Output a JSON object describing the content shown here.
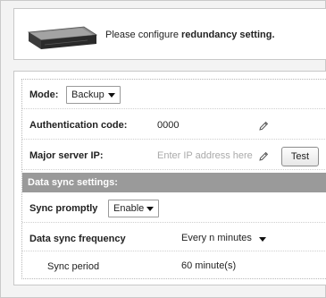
{
  "header": {
    "message_prefix": "Please configure ",
    "message_bold": "redundancy setting."
  },
  "form": {
    "mode": {
      "label": "Mode:",
      "value": "Backup"
    },
    "auth_code": {
      "label": "Authentication code:",
      "value": "0000"
    },
    "major_server_ip": {
      "label": "Major server IP:",
      "placeholder": "Enter IP address here",
      "test_button": "Test"
    },
    "data_sync_section": {
      "title": "Data sync settings:"
    },
    "sync_promptly": {
      "label": "Sync promptly",
      "value": "Enable"
    },
    "data_sync_frequency": {
      "label": "Data sync frequency",
      "value": "Every n minutes"
    },
    "sync_period": {
      "label": "Sync period",
      "value": "60 minute(s)"
    }
  },
  "icons": {
    "device": "nvr-device-icon",
    "edit": "pencil-icon",
    "dropdown": "caret-down-icon"
  }
}
